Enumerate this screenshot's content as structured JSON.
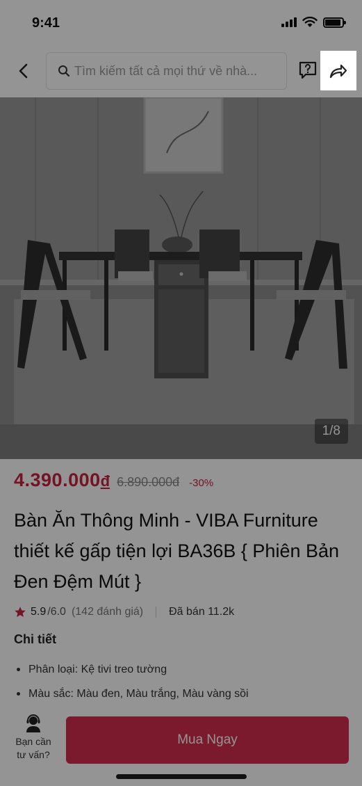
{
  "status_bar": {
    "time": "9:41"
  },
  "nav": {
    "search_placeholder": "Tìm kiếm tất cả mọi thứ về nhà...",
    "back_icon": "chevron-left-icon",
    "help_icon": "help-question-icon",
    "share_icon": "share-arrow-icon"
  },
  "gallery": {
    "counter": "1/8"
  },
  "product": {
    "price": "4.390.000",
    "price_unit": "đ",
    "old_price": "6.890.000đ",
    "discount": "-30%",
    "title": "Bàn Ăn Thông Minh - VIBA Furniture thiết kế gấp tiện lợi BA36B { Phiên Bản Đen Đệm Mút }",
    "rating": "5.9",
    "rating_max": "/6.0",
    "review_count": "(142 đánh giá)",
    "sold": "Đã bán 11.2k"
  },
  "details": {
    "heading": "Chi tiết",
    "items": [
      "Phân loại: Kệ tivi treo tường",
      "Màu sắc: Màu đen, Màu trắng, Màu vàng sồi"
    ]
  },
  "bottom": {
    "advisor_label_line1": "Bạn cần",
    "advisor_label_line2": "tư vấn?",
    "buy_label": "Mua Ngay"
  },
  "colors": {
    "accent": "#d42e4c",
    "price": "#c8213f",
    "overlay": "rgba(0,0,0,0.42)"
  }
}
